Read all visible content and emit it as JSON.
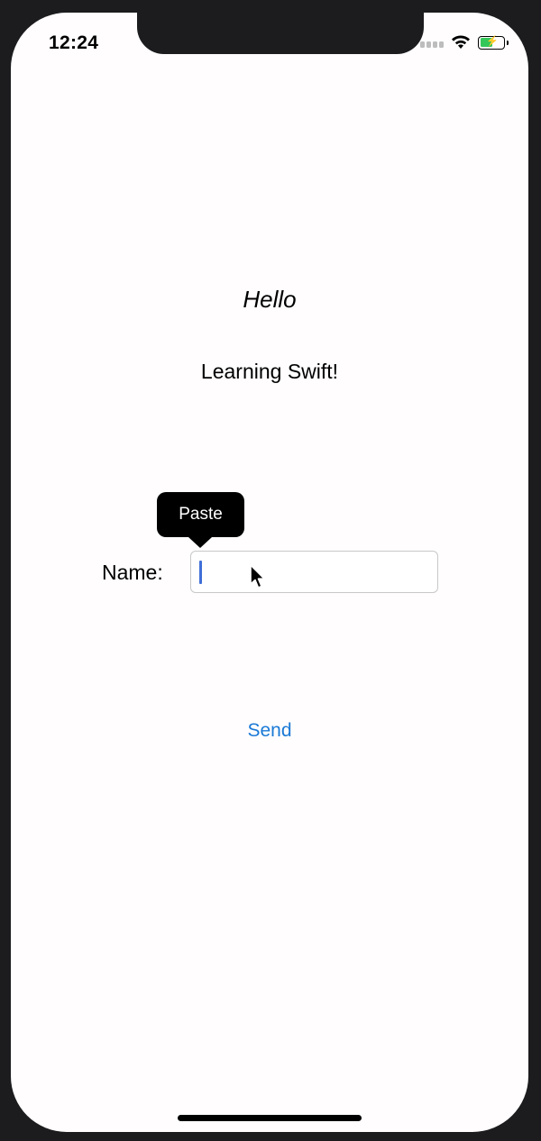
{
  "status_bar": {
    "time": "12:24"
  },
  "main": {
    "greeting": "Hello",
    "subtitle": "Learning Swift!",
    "name_label": "Name:",
    "name_value": "",
    "send_label": "Send"
  },
  "edit_menu": {
    "paste_label": "Paste"
  },
  "colors": {
    "accent": "#1a7ad6",
    "battery": "#34c759",
    "caret": "#3f6fd8"
  },
  "icons": {
    "signal": "cellular-signal-icon",
    "wifi": "wifi-icon",
    "battery": "battery-charging-icon",
    "pointer": "mouse-pointer-icon"
  },
  "battery_level": 0.55
}
